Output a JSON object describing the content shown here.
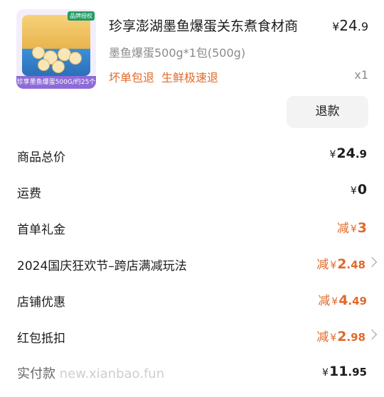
{
  "product": {
    "badge": "品牌授权",
    "thumb_caption": "珍享墨鱼爆蛋500G/约25个",
    "title": "珍享澎湖墨鱼爆蛋关东煮食材商",
    "spec": "墨鱼爆蛋500g*1包(500g)",
    "promises": [
      "坏单包退",
      "生鲜极速退"
    ],
    "price_currency": "¥",
    "price_int": "24",
    "price_dec": ".9",
    "quantity": "x1",
    "refund_button": "退款"
  },
  "breakdown": [
    {
      "label": "商品总价",
      "prefix": "",
      "currency": "¥",
      "int": "24",
      "dec": ".9",
      "color": "#1c1c1c",
      "arrow": false
    },
    {
      "label": "运费",
      "prefix": "",
      "currency": "¥",
      "int": "0",
      "dec": "",
      "color": "#1c1c1c",
      "arrow": false
    },
    {
      "label": "首单礼金",
      "prefix": "减",
      "currency": "¥",
      "int": "3",
      "dec": "",
      "color": "#e06a2a",
      "arrow": false
    },
    {
      "label": "2024国庆狂欢节–跨店满减玩法",
      "prefix": "减",
      "currency": "¥",
      "int": "2",
      "dec": ".48",
      "color": "#e06a2a",
      "arrow": true
    },
    {
      "label": "店铺优惠",
      "prefix": "减",
      "currency": "¥",
      "int": "4",
      "dec": ".49",
      "color": "#e06a2a",
      "arrow": false
    },
    {
      "label": "红包抵扣",
      "prefix": "减",
      "currency": "¥",
      "int": "2",
      "dec": ".98",
      "color": "#e06a2a",
      "arrow": true
    }
  ],
  "total": {
    "label": "实付款",
    "watermark": "new.xianbao.fun",
    "currency": "¥",
    "int": "11",
    "dec": ".95"
  }
}
